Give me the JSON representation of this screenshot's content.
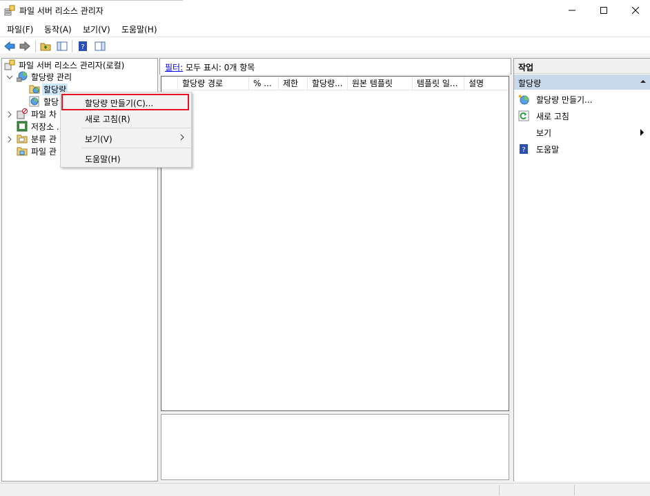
{
  "window": {
    "title": "파일 서버 리소스 관리자"
  },
  "menubar": {
    "items": [
      "파일(F)",
      "동작(A)",
      "보기(V)",
      "도움말(H)"
    ]
  },
  "toolbar": {
    "icons": [
      "back-arrow-icon",
      "forward-arrow-icon",
      "folder-up-icon",
      "show-hide-tree-icon",
      "help-icon",
      "action-pane-icon"
    ]
  },
  "tree": {
    "root": "파일 서버 리소스 관리자(로컬)",
    "quota_mgmt": "할당량 관리",
    "quotas": "할당량",
    "quota_templates": "할당",
    "file_screen": "파일 차",
    "storage": "저장소 .",
    "classification": "분류 관",
    "file_mgmt": "파일 관"
  },
  "filter": {
    "link": "필터:",
    "text": " 모두 표시: 0개 항목"
  },
  "columns": [
    "할당량 경로",
    "% ...",
    "제한",
    "할당량...",
    "원본 템플릿",
    "템플릿 일...",
    "설명"
  ],
  "actions": {
    "header": "작업",
    "section": "할당량",
    "items": [
      "할당량 만들기...",
      "새로 고침",
      "보기",
      "도움말"
    ]
  },
  "context_menu": {
    "items": [
      "할당량 만들기(C)...",
      "새로 고침(R)",
      "보기(V)",
      "도움말(H)"
    ]
  },
  "colors": {
    "highlight_border": "#e81123",
    "selection": "#cce8ff",
    "section_bg": "#c9d9ec"
  }
}
